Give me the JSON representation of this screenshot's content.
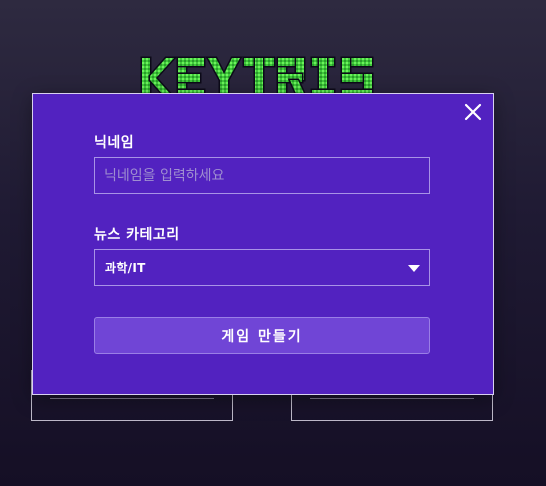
{
  "logo": {
    "text": "KEYTRIS"
  },
  "modal": {
    "nickname_label": "닉네임",
    "nickname_placeholder": "닉네임을 입력하세요",
    "nickname_value": "",
    "category_label": "뉴스 카테고리",
    "category_selected": "과학/IT",
    "create_button": "게임 만들기",
    "close_icon": "close-icon"
  },
  "colors": {
    "modal_bg": "#5222c0",
    "button_bg": "#7045d6",
    "logo_green": "#4ade3a"
  }
}
